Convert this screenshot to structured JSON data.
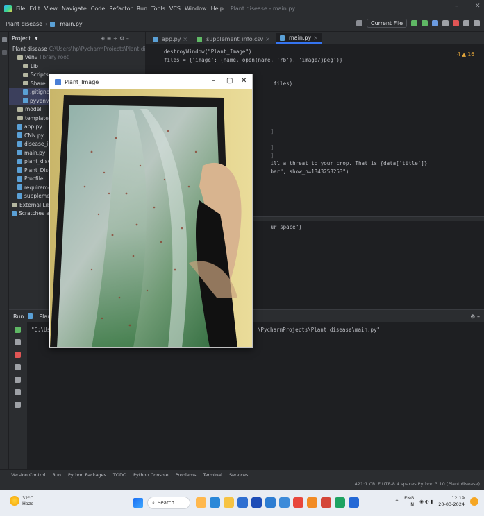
{
  "menubar": {
    "items": [
      "File",
      "Edit",
      "View",
      "Navigate",
      "Code",
      "Refactor",
      "Run",
      "Tools",
      "VCS",
      "Window",
      "Help"
    ],
    "project_title": "Plant disease - main.py"
  },
  "navbar": {
    "crumb1": "Plant disease",
    "crumb2": "main.py",
    "run_config": "Current File"
  },
  "project_panel": {
    "header": "Project",
    "items": [
      {
        "label": "Plant disease",
        "extra": "C:\\Users\\hp\\PycharmProjects\\Plant disease"
      },
      {
        "label": "venv",
        "extra": "library root"
      },
      {
        "label": "Lib",
        "extra": ""
      },
      {
        "label": "Scripts",
        "extra": ""
      },
      {
        "label": "Share",
        "extra": ""
      },
      {
        "label": ".gitignore",
        "extra": ""
      },
      {
        "label": "pyvenv.cfg",
        "extra": ""
      },
      {
        "label": "model",
        "extra": ""
      },
      {
        "label": "templates",
        "extra": ""
      },
      {
        "label": "app.py",
        "extra": ""
      },
      {
        "label": "CNN.py",
        "extra": ""
      },
      {
        "label": "disease_info.csv",
        "extra": ""
      },
      {
        "label": "main.py",
        "extra": ""
      },
      {
        "label": "plant_disease_model.pt",
        "extra": ""
      },
      {
        "label": "Plant_Disease.ipynb",
        "extra": ""
      },
      {
        "label": "Procfile",
        "extra": ""
      },
      {
        "label": "requirements.txt",
        "extra": ""
      },
      {
        "label": "supplement_info.csv",
        "extra": ""
      },
      {
        "label": "External Libraries",
        "extra": ""
      },
      {
        "label": "Scratches and Consoles",
        "extra": ""
      }
    ]
  },
  "tabs": [
    "app.py",
    "supplement_info.csv",
    "main.py"
  ],
  "editor": {
    "warning": "4 ▲ 16",
    "lines": [
      "destroyWindow(\"Plant_Image\")",
      "files = {'image': (name, open(name, 'rb'), 'image/jpeg')}",
      "",
      "",
      "                                   files)",
      "",
      "",
      "",
      "",
      "",
      "                                  ]",
      "",
      "                                  ]",
      "                                  ]",
      "                                  ill a threat to your crop. That is {data['title']}",
      "                                  ber\", show_n=1343253253\")",
      "",
      "",
      "",
      "",
      "",
      "",
      "                                  ur space\")"
    ]
  },
  "run_panel": {
    "tab_label": "Run",
    "config_name": "Plant disease",
    "command_left": "\"C:\\Users\\hp\\",
    "command_right": "\\PycharmProjects\\Plant disease\\main.py\""
  },
  "bottom_tools": [
    "Version Control",
    "Run",
    "Python Packages",
    "TODO",
    "Python Console",
    "Problems",
    "Terminal",
    "Services"
  ],
  "status": {
    "right": "421:1   CRLF   UTF-8   4 spaces   Python 3.10 (Plant disease)"
  },
  "popup": {
    "title": "Plant_Image"
  },
  "taskbar": {
    "weather_temp": "32°C",
    "weather_desc": "Haze",
    "search": "Search",
    "lang1": "ENG",
    "lang2": "IN",
    "time": "12:19",
    "date": "20-03-2024"
  }
}
